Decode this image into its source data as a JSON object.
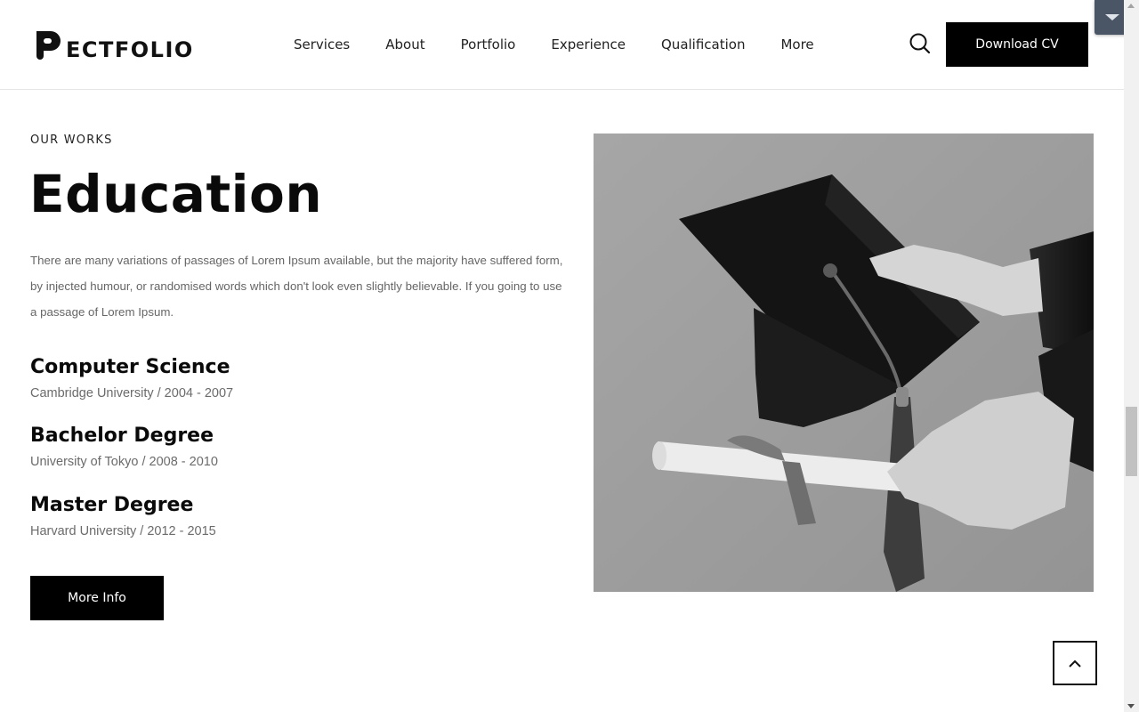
{
  "header": {
    "logo_text": "ECTFOLIO",
    "nav": [
      {
        "label": "Services"
      },
      {
        "label": "About"
      },
      {
        "label": "Portfolio"
      },
      {
        "label": "Experience"
      },
      {
        "label": "Qualification"
      },
      {
        "label": "More"
      }
    ],
    "search_icon": "search-icon",
    "cta_label": "Download CV"
  },
  "section": {
    "eyebrow": "OUR WORKS",
    "title": "Education",
    "description": "There are many variations of passages of Lorem Ipsum available, but the majority have suffered form, by injected humour, or randomised words which don't look even slightly believable. If you going to use a passage of Lorem Ipsum.",
    "items": [
      {
        "degree": "Computer Science",
        "meta": "Cambridge University / 2004 - 2007"
      },
      {
        "degree": "Bachelor Degree",
        "meta": "University of Tokyo / 2008 - 2010"
      },
      {
        "degree": "Master Degree",
        "meta": "Harvard University / 2012 - 2015"
      }
    ],
    "button_label": "More Info"
  },
  "icons": {
    "back_to_top": "chevron-up-icon",
    "corner_toggle": "caret-down-icon"
  },
  "colors": {
    "primary": "#000000",
    "text": "#0a0a0a",
    "muted": "#666666",
    "toggle": "#4a5566"
  }
}
